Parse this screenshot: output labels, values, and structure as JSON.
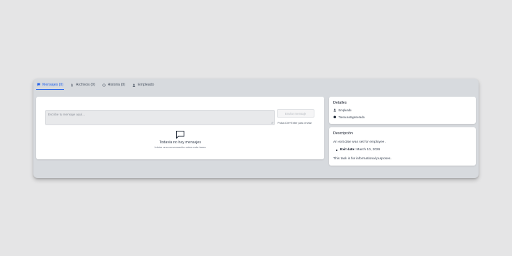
{
  "tabs": [
    {
      "label": "Mensajes (0)",
      "icon": "chat-bubble-icon",
      "active": true
    },
    {
      "label": "Archivos (0)",
      "icon": "paperclip-icon",
      "active": false
    },
    {
      "label": "Historia (0)",
      "icon": "clock-icon",
      "active": false
    },
    {
      "label": "Empleado",
      "icon": "person-icon",
      "active": false
    }
  ],
  "messages": {
    "input_placeholder": "Escribe tu mensaje aquí...",
    "send_label": "Enviar mensaje",
    "hint": "Pulsa Ctrl+Enter para enviar",
    "empty_title": "Todavía no hay mensajes",
    "empty_subtitle": "Iniciar una conversación sobre esta tarea"
  },
  "details": {
    "title": "Detalles",
    "assignee": "Empleado",
    "status": "Tarea autogenerada"
  },
  "description": {
    "title": "Descripción",
    "line1": "An exit date was set for employee .",
    "bullet_label": "Exit date:",
    "bullet_value": "March 10, 2026",
    "line2": "This task is for informational purposes."
  },
  "colors": {
    "accent": "#2563eb",
    "page_bg": "#e5e5e6",
    "panel_bg": "#d7dade"
  }
}
